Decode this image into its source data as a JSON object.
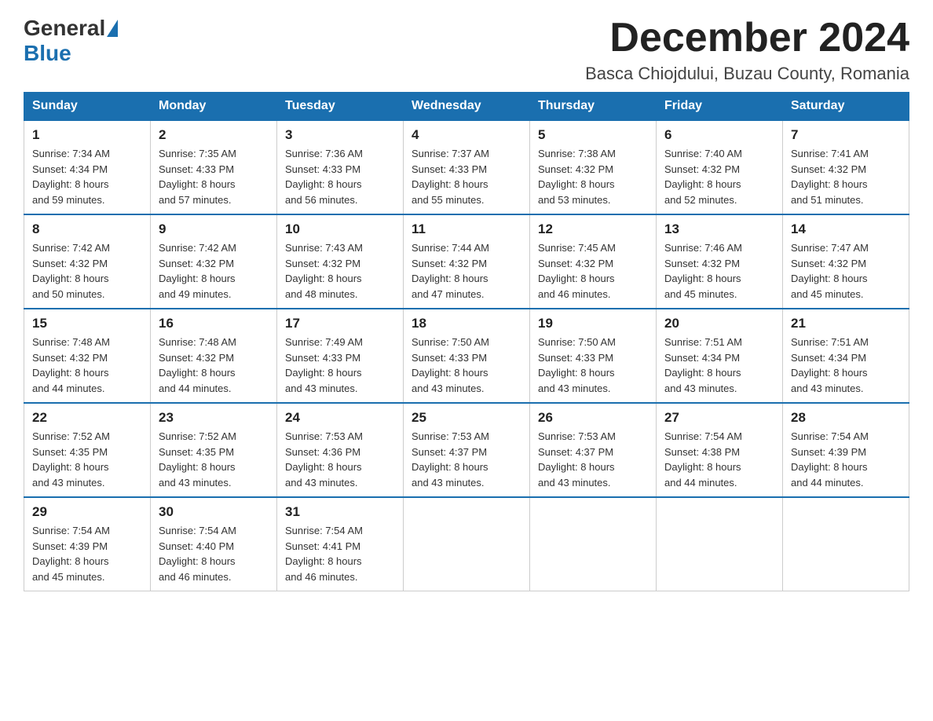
{
  "logo": {
    "general": "General",
    "blue": "Blue"
  },
  "title": "December 2024",
  "location": "Basca Chiojdului, Buzau County, Romania",
  "days_of_week": [
    "Sunday",
    "Monday",
    "Tuesday",
    "Wednesday",
    "Thursday",
    "Friday",
    "Saturday"
  ],
  "weeks": [
    [
      {
        "day": "1",
        "sunrise": "7:34 AM",
        "sunset": "4:34 PM",
        "daylight": "8 hours and 59 minutes."
      },
      {
        "day": "2",
        "sunrise": "7:35 AM",
        "sunset": "4:33 PM",
        "daylight": "8 hours and 57 minutes."
      },
      {
        "day": "3",
        "sunrise": "7:36 AM",
        "sunset": "4:33 PM",
        "daylight": "8 hours and 56 minutes."
      },
      {
        "day": "4",
        "sunrise": "7:37 AM",
        "sunset": "4:33 PM",
        "daylight": "8 hours and 55 minutes."
      },
      {
        "day": "5",
        "sunrise": "7:38 AM",
        "sunset": "4:32 PM",
        "daylight": "8 hours and 53 minutes."
      },
      {
        "day": "6",
        "sunrise": "7:40 AM",
        "sunset": "4:32 PM",
        "daylight": "8 hours and 52 minutes."
      },
      {
        "day": "7",
        "sunrise": "7:41 AM",
        "sunset": "4:32 PM",
        "daylight": "8 hours and 51 minutes."
      }
    ],
    [
      {
        "day": "8",
        "sunrise": "7:42 AM",
        "sunset": "4:32 PM",
        "daylight": "8 hours and 50 minutes."
      },
      {
        "day": "9",
        "sunrise": "7:42 AM",
        "sunset": "4:32 PM",
        "daylight": "8 hours and 49 minutes."
      },
      {
        "day": "10",
        "sunrise": "7:43 AM",
        "sunset": "4:32 PM",
        "daylight": "8 hours and 48 minutes."
      },
      {
        "day": "11",
        "sunrise": "7:44 AM",
        "sunset": "4:32 PM",
        "daylight": "8 hours and 47 minutes."
      },
      {
        "day": "12",
        "sunrise": "7:45 AM",
        "sunset": "4:32 PM",
        "daylight": "8 hours and 46 minutes."
      },
      {
        "day": "13",
        "sunrise": "7:46 AM",
        "sunset": "4:32 PM",
        "daylight": "8 hours and 45 minutes."
      },
      {
        "day": "14",
        "sunrise": "7:47 AM",
        "sunset": "4:32 PM",
        "daylight": "8 hours and 45 minutes."
      }
    ],
    [
      {
        "day": "15",
        "sunrise": "7:48 AM",
        "sunset": "4:32 PM",
        "daylight": "8 hours and 44 minutes."
      },
      {
        "day": "16",
        "sunrise": "7:48 AM",
        "sunset": "4:32 PM",
        "daylight": "8 hours and 44 minutes."
      },
      {
        "day": "17",
        "sunrise": "7:49 AM",
        "sunset": "4:33 PM",
        "daylight": "8 hours and 43 minutes."
      },
      {
        "day": "18",
        "sunrise": "7:50 AM",
        "sunset": "4:33 PM",
        "daylight": "8 hours and 43 minutes."
      },
      {
        "day": "19",
        "sunrise": "7:50 AM",
        "sunset": "4:33 PM",
        "daylight": "8 hours and 43 minutes."
      },
      {
        "day": "20",
        "sunrise": "7:51 AM",
        "sunset": "4:34 PM",
        "daylight": "8 hours and 43 minutes."
      },
      {
        "day": "21",
        "sunrise": "7:51 AM",
        "sunset": "4:34 PM",
        "daylight": "8 hours and 43 minutes."
      }
    ],
    [
      {
        "day": "22",
        "sunrise": "7:52 AM",
        "sunset": "4:35 PM",
        "daylight": "8 hours and 43 minutes."
      },
      {
        "day": "23",
        "sunrise": "7:52 AM",
        "sunset": "4:35 PM",
        "daylight": "8 hours and 43 minutes."
      },
      {
        "day": "24",
        "sunrise": "7:53 AM",
        "sunset": "4:36 PM",
        "daylight": "8 hours and 43 minutes."
      },
      {
        "day": "25",
        "sunrise": "7:53 AM",
        "sunset": "4:37 PM",
        "daylight": "8 hours and 43 minutes."
      },
      {
        "day": "26",
        "sunrise": "7:53 AM",
        "sunset": "4:37 PM",
        "daylight": "8 hours and 43 minutes."
      },
      {
        "day": "27",
        "sunrise": "7:54 AM",
        "sunset": "4:38 PM",
        "daylight": "8 hours and 44 minutes."
      },
      {
        "day": "28",
        "sunrise": "7:54 AM",
        "sunset": "4:39 PM",
        "daylight": "8 hours and 44 minutes."
      }
    ],
    [
      {
        "day": "29",
        "sunrise": "7:54 AM",
        "sunset": "4:39 PM",
        "daylight": "8 hours and 45 minutes."
      },
      {
        "day": "30",
        "sunrise": "7:54 AM",
        "sunset": "4:40 PM",
        "daylight": "8 hours and 46 minutes."
      },
      {
        "day": "31",
        "sunrise": "7:54 AM",
        "sunset": "4:41 PM",
        "daylight": "8 hours and 46 minutes."
      },
      null,
      null,
      null,
      null
    ]
  ],
  "labels": {
    "sunrise": "Sunrise:",
    "sunset": "Sunset:",
    "daylight": "Daylight:"
  }
}
